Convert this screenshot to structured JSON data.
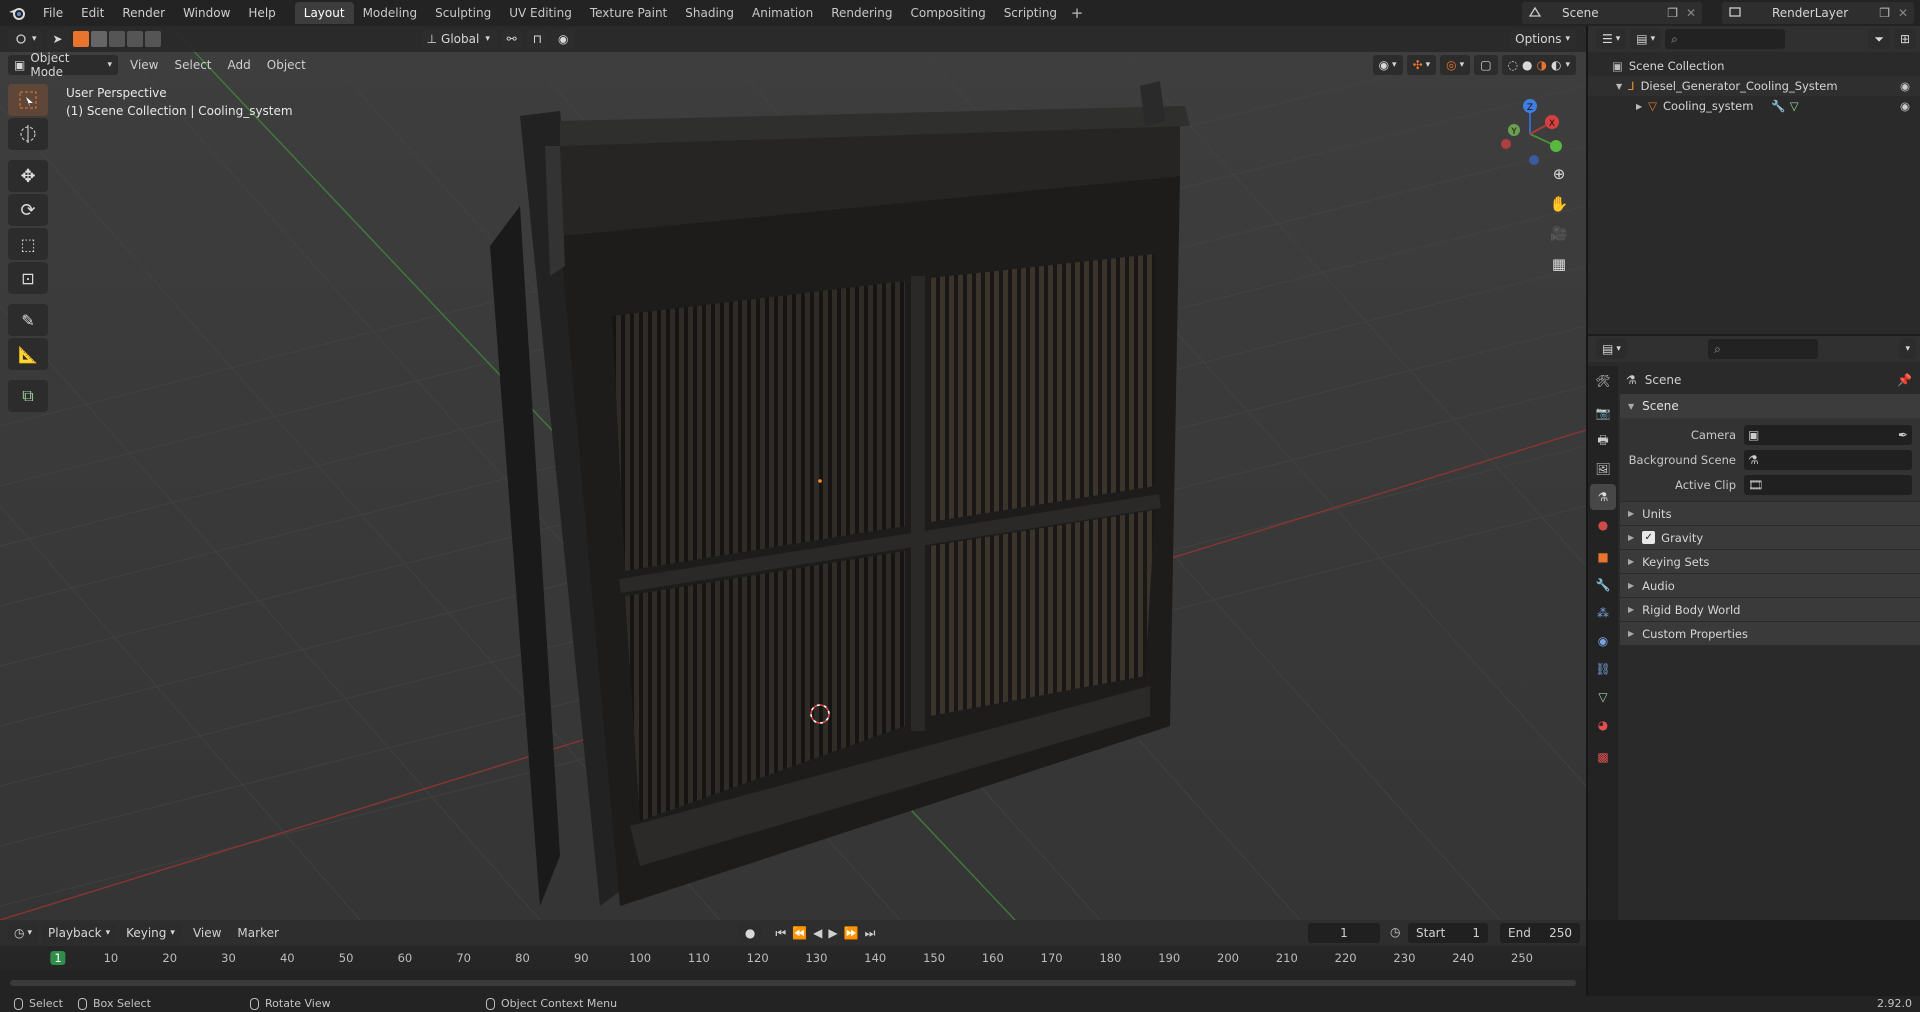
{
  "menu": {
    "items": [
      "File",
      "Edit",
      "Render",
      "Window",
      "Help"
    ]
  },
  "workspaces": {
    "tabs": [
      "Layout",
      "Modeling",
      "Sculpting",
      "UV Editing",
      "Texture Paint",
      "Shading",
      "Animation",
      "Rendering",
      "Compositing",
      "Scripting"
    ],
    "active": "Layout",
    "add_label": "+"
  },
  "scene_selector": {
    "value": "Scene"
  },
  "view_layer_selector": {
    "value": "RenderLayer"
  },
  "viewport": {
    "transform_orientation": "Global",
    "options_label": "Options",
    "mode": "Object Mode",
    "menus": [
      "View",
      "Select",
      "Add",
      "Object"
    ],
    "perspective_label": "User Perspective",
    "collection_label": "(1) Scene Collection | Cooling_system",
    "gizmo_axes": {
      "x": "X",
      "y": "Y",
      "z": "Z"
    }
  },
  "outliner": {
    "root": "Scene Collection",
    "items": [
      {
        "name": "Diesel_Generator_Cooling_System"
      },
      {
        "name": "Cooling_system"
      }
    ]
  },
  "properties": {
    "context": "Scene",
    "section": "Scene",
    "fields": [
      {
        "label": "Camera",
        "value": ""
      },
      {
        "label": "Background Scene",
        "value": ""
      },
      {
        "label": "Active Clip",
        "value": ""
      }
    ],
    "subpanels": [
      {
        "label": "Units",
        "checkbox": false
      },
      {
        "label": "Gravity",
        "checkbox": true,
        "checked": true
      },
      {
        "label": "Keying Sets",
        "checkbox": false
      },
      {
        "label": "Audio",
        "checkbox": false
      },
      {
        "label": "Rigid Body World",
        "checkbox": false
      },
      {
        "label": "Custom Properties",
        "checkbox": false
      }
    ]
  },
  "timeline": {
    "playback_label": "Playback",
    "keying_label": "Keying",
    "view_label": "View",
    "marker_label": "Marker",
    "current_frame": "1",
    "start_label": "Start",
    "start_value": "1",
    "end_label": "End",
    "end_value": "250",
    "ruler_labels": [
      "1",
      "10",
      "20",
      "30",
      "40",
      "50",
      "60",
      "70",
      "80",
      "90",
      "100",
      "110",
      "120",
      "130",
      "140",
      "150",
      "160",
      "170",
      "180",
      "190",
      "200",
      "210",
      "220",
      "230",
      "240",
      "250"
    ]
  },
  "statusbar": {
    "select": "Select",
    "box_select": "Box Select",
    "rotate_view": "Rotate View",
    "context_menu": "Object Context Menu",
    "version": "2.92.0"
  },
  "colors": {
    "accent": "#e8742d",
    "active_tab": "#3d3d3d",
    "viewport_bg": "#393939",
    "axis_x": "#b03a3a",
    "axis_y": "#4b8a3b",
    "current_frame": "#2f8f4a"
  }
}
